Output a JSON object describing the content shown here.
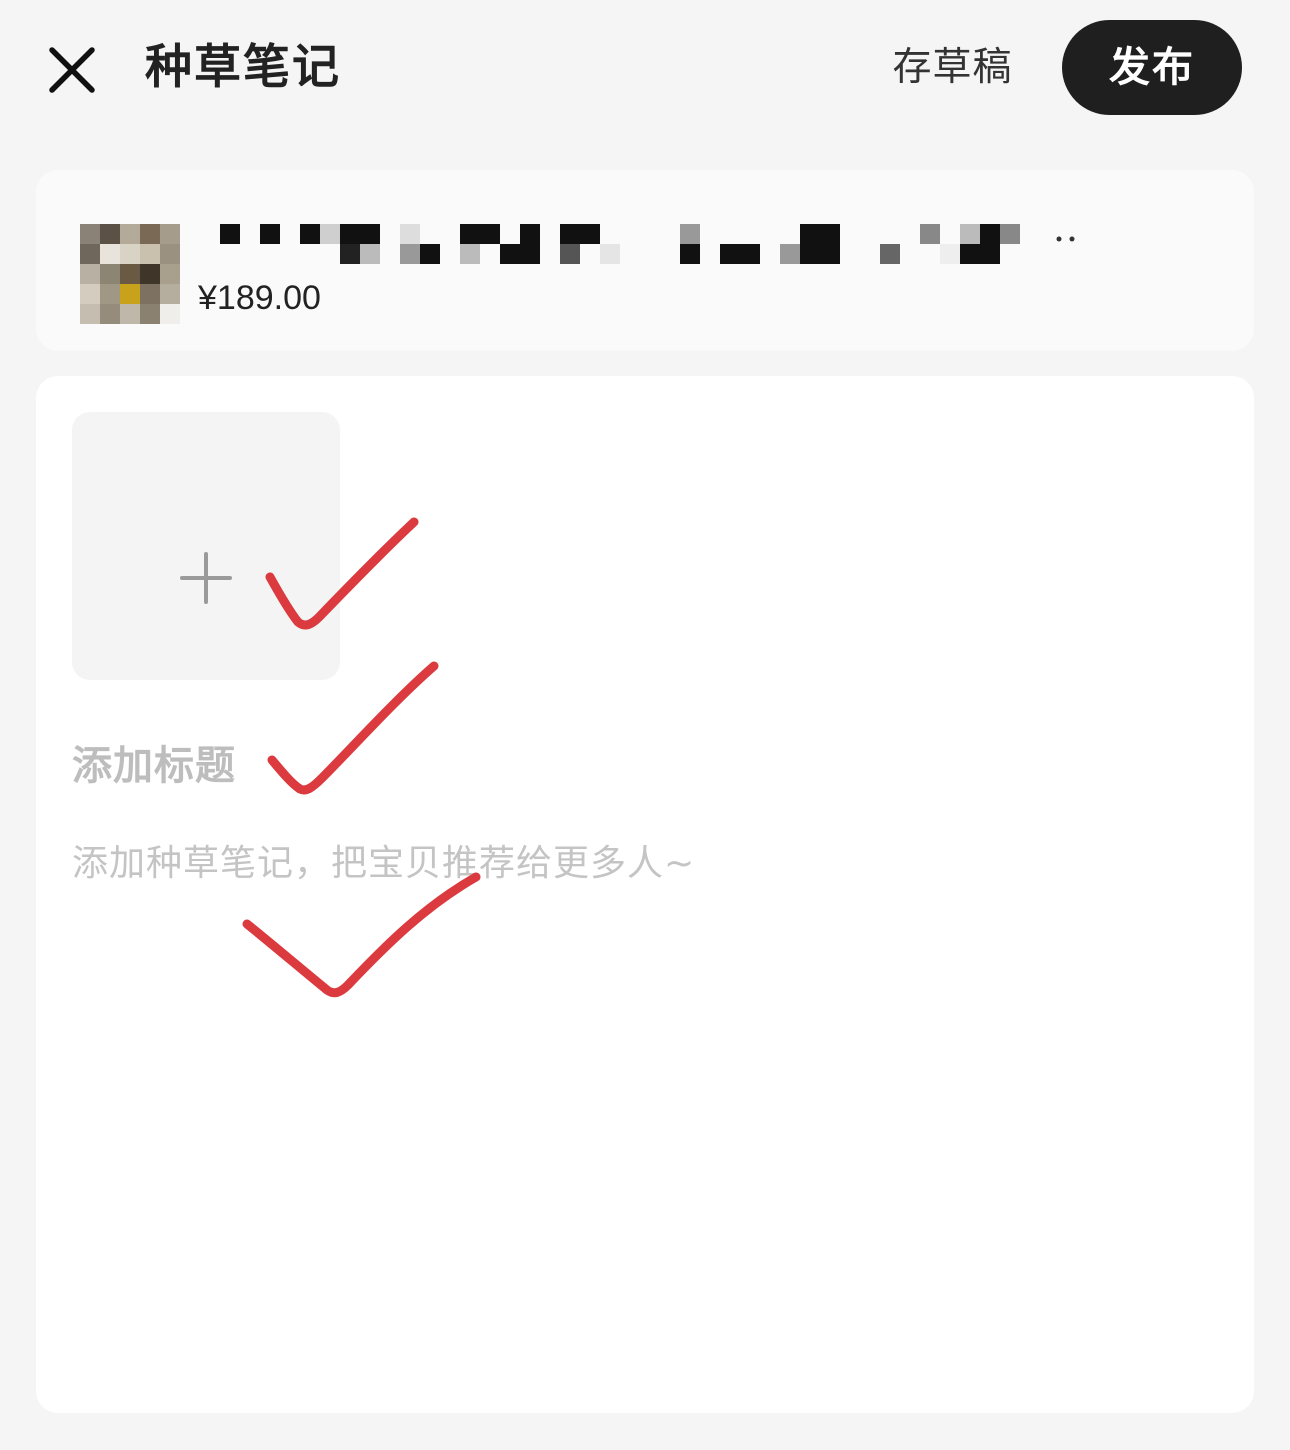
{
  "header": {
    "title": "种草笔记",
    "close_icon": "close-icon",
    "save_draft_label": "存草稿",
    "publish_label": "发布"
  },
  "product": {
    "price": "¥189.00",
    "name_blurred": true
  },
  "editor": {
    "add_image_icon": "plus-icon",
    "title_placeholder": "添加标题",
    "body_placeholder": "添加种草笔记，把宝贝推荐给更多人~"
  },
  "annotations": {
    "type": "checkmark",
    "count": 3,
    "color": "#db3a3f"
  },
  "colors": {
    "background": "#f5f5f5",
    "card": "#ffffff",
    "publish_button": "#1f1f1f",
    "placeholder": "#bdbdbd",
    "annotation": "#db3a3f"
  }
}
